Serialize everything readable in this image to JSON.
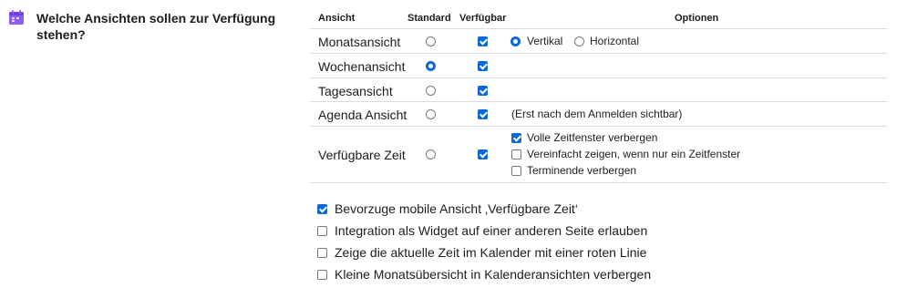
{
  "section": {
    "icon": "calendar-icon",
    "title": "Welche Ansichten sollen zur Verfügung stehen?"
  },
  "table": {
    "headers": {
      "view": "Ansicht",
      "default": "Standard",
      "available": "Verfügbar",
      "options": "Optionen"
    },
    "rows": [
      {
        "label": "Monatsansicht",
        "default": false,
        "available": true,
        "orientation": {
          "vertical": {
            "label": "Vertikal",
            "selected": true
          },
          "horizontal": {
            "label": "Horizontal",
            "selected": false
          }
        }
      },
      {
        "label": "Wochenansicht",
        "default": true,
        "available": true
      },
      {
        "label": "Tagesansicht",
        "default": false,
        "available": true
      },
      {
        "label": "Agenda Ansicht",
        "default": false,
        "available": true,
        "note": "(Erst nach dem Anmelden sichtbar)"
      },
      {
        "label": "Verfügbare Zeit",
        "default": false,
        "available": true,
        "options": [
          {
            "label": "Volle Zeitfenster verbergen",
            "checked": true
          },
          {
            "label": "Vereinfacht zeigen, wenn nur ein Zeitfenster",
            "checked": false
          },
          {
            "label": "Terminende verbergen",
            "checked": false
          }
        ]
      }
    ]
  },
  "preferences": [
    {
      "label": "Bevorzuge mobile Ansicht ‚Verfügbare Zeit‘",
      "checked": true
    },
    {
      "label": "Integration als Widget auf einer anderen Seite erlauben",
      "checked": false
    },
    {
      "label": "Zeige die aktuelle Zeit im Kalender mit einer roten Linie",
      "checked": false
    },
    {
      "label": "Kleine Monatsübersicht in Kalenderansichten verbergen",
      "checked": false
    }
  ],
  "colors": {
    "accent": "#0a68d8",
    "icon": "#8b5cf6",
    "divider": "#dcdcdc"
  }
}
